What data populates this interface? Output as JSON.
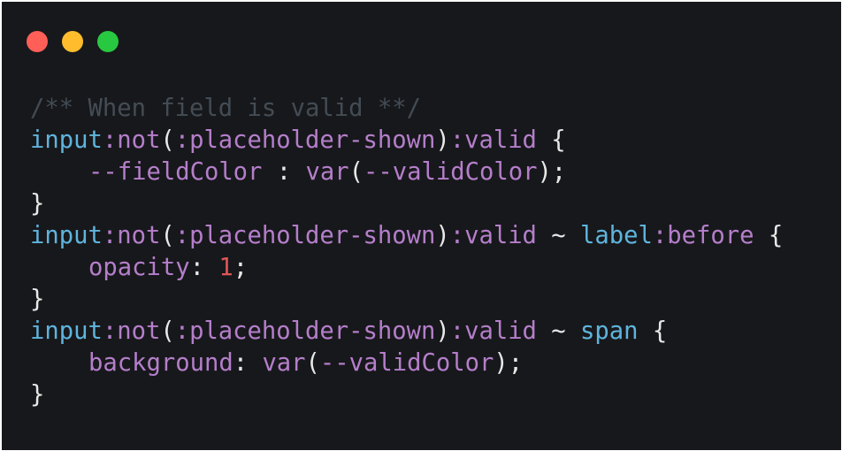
{
  "window": {
    "controls": [
      {
        "name": "close",
        "color": "#ff5f57"
      },
      {
        "name": "minimize",
        "color": "#ffbd2e"
      },
      {
        "name": "maximize",
        "color": "#28c840"
      }
    ]
  },
  "theme": {
    "background": "#17181b",
    "comment": "#434c55",
    "tag": "#5fb4dd",
    "pseudo": "#b57ecb",
    "number": "#e05656",
    "text": "#e8e8e8"
  },
  "code": {
    "language": "css",
    "lines": [
      {
        "indent": 0,
        "tokens": [
          {
            "t": "comment",
            "v": "/** When field is valid **/"
          }
        ]
      },
      {
        "indent": 0,
        "tokens": [
          {
            "t": "tag",
            "v": "input"
          },
          {
            "t": "pseudo",
            "v": ":not"
          },
          {
            "t": "punct",
            "v": "("
          },
          {
            "t": "pseudo",
            "v": ":placeholder-shown"
          },
          {
            "t": "punct",
            "v": ")"
          },
          {
            "t": "pseudo",
            "v": ":valid"
          },
          {
            "t": "punct",
            "v": " {"
          }
        ]
      },
      {
        "indent": 1,
        "tokens": [
          {
            "t": "prop",
            "v": "--fieldColor"
          },
          {
            "t": "punct",
            "v": " : "
          },
          {
            "t": "prop",
            "v": "var"
          },
          {
            "t": "punct",
            "v": "("
          },
          {
            "t": "prop",
            "v": "--validColor"
          },
          {
            "t": "punct",
            "v": ");"
          }
        ]
      },
      {
        "indent": 0,
        "tokens": [
          {
            "t": "punct",
            "v": "}"
          }
        ]
      },
      {
        "indent": 0,
        "tokens": [
          {
            "t": "tag",
            "v": "input"
          },
          {
            "t": "pseudo",
            "v": ":not"
          },
          {
            "t": "punct",
            "v": "("
          },
          {
            "t": "pseudo",
            "v": ":placeholder-shown"
          },
          {
            "t": "punct",
            "v": ")"
          },
          {
            "t": "pseudo",
            "v": ":valid"
          },
          {
            "t": "punct",
            "v": " ~ "
          },
          {
            "t": "tag",
            "v": "label"
          },
          {
            "t": "pseudo",
            "v": ":before"
          },
          {
            "t": "punct",
            "v": " {"
          }
        ]
      },
      {
        "indent": 1,
        "tokens": [
          {
            "t": "prop",
            "v": "opacity"
          },
          {
            "t": "punct",
            "v": ": "
          },
          {
            "t": "num",
            "v": "1"
          },
          {
            "t": "punct",
            "v": ";"
          }
        ]
      },
      {
        "indent": 0,
        "tokens": [
          {
            "t": "punct",
            "v": "}"
          }
        ]
      },
      {
        "indent": 0,
        "tokens": [
          {
            "t": "tag",
            "v": "input"
          },
          {
            "t": "pseudo",
            "v": ":not"
          },
          {
            "t": "punct",
            "v": "("
          },
          {
            "t": "pseudo",
            "v": ":placeholder-shown"
          },
          {
            "t": "punct",
            "v": ")"
          },
          {
            "t": "pseudo",
            "v": ":valid"
          },
          {
            "t": "punct",
            "v": " ~ "
          },
          {
            "t": "tag",
            "v": "span"
          },
          {
            "t": "punct",
            "v": " {"
          }
        ]
      },
      {
        "indent": 1,
        "tokens": [
          {
            "t": "prop",
            "v": "background"
          },
          {
            "t": "punct",
            "v": ": "
          },
          {
            "t": "prop",
            "v": "var"
          },
          {
            "t": "punct",
            "v": "("
          },
          {
            "t": "prop",
            "v": "--validColor"
          },
          {
            "t": "punct",
            "v": ");"
          }
        ]
      },
      {
        "indent": 0,
        "tokens": [
          {
            "t": "punct",
            "v": "}"
          }
        ]
      }
    ]
  }
}
